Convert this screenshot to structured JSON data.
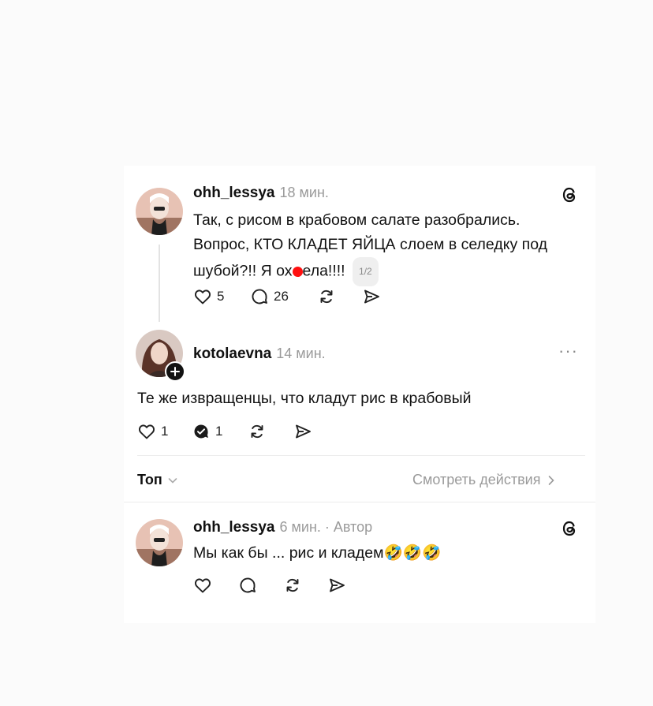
{
  "colors": {
    "text": "#111111",
    "muted": "#9a9a9a",
    "divider": "#ececec",
    "redact": "#ff1010"
  },
  "post1": {
    "username": "ohh_lessya",
    "time": "18 мин.",
    "text_l1": "Так, с рисом в крабовом салате разобрались.",
    "text_l2": "Вопрос, КТО КЛАДЕТ ЯЙЦА слоем в селедку под",
    "text_l3a": "шубой?!! Я ох",
    "text_l3b": "ела!!!!",
    "page_badge": "1/2",
    "likes": "5",
    "replies": "26",
    "icons": [
      "threads-logo-icon",
      "heart-icon",
      "comment-icon",
      "repost-icon",
      "share-icon"
    ]
  },
  "post2": {
    "username": "kotolaevna",
    "time": "14 мин.",
    "more": "···",
    "text": "Те же извращенцы, что кладут рис в крабовый",
    "likes": "1",
    "replies": "1",
    "icons": [
      "heart-icon",
      "comment-check-icon",
      "repost-icon",
      "share-icon",
      "follow-plus-icon"
    ]
  },
  "sort_bar": {
    "sort_label": "Топ",
    "activity_label": "Смотреть действия"
  },
  "post3": {
    "username": "ohh_lessya",
    "time": "6 мин. · Автор",
    "text": "Мы как бы ... рис и кладем",
    "emoji": "🤣🤣🤣",
    "icons": [
      "threads-logo-icon",
      "heart-icon",
      "comment-icon",
      "repost-icon",
      "share-icon"
    ]
  }
}
